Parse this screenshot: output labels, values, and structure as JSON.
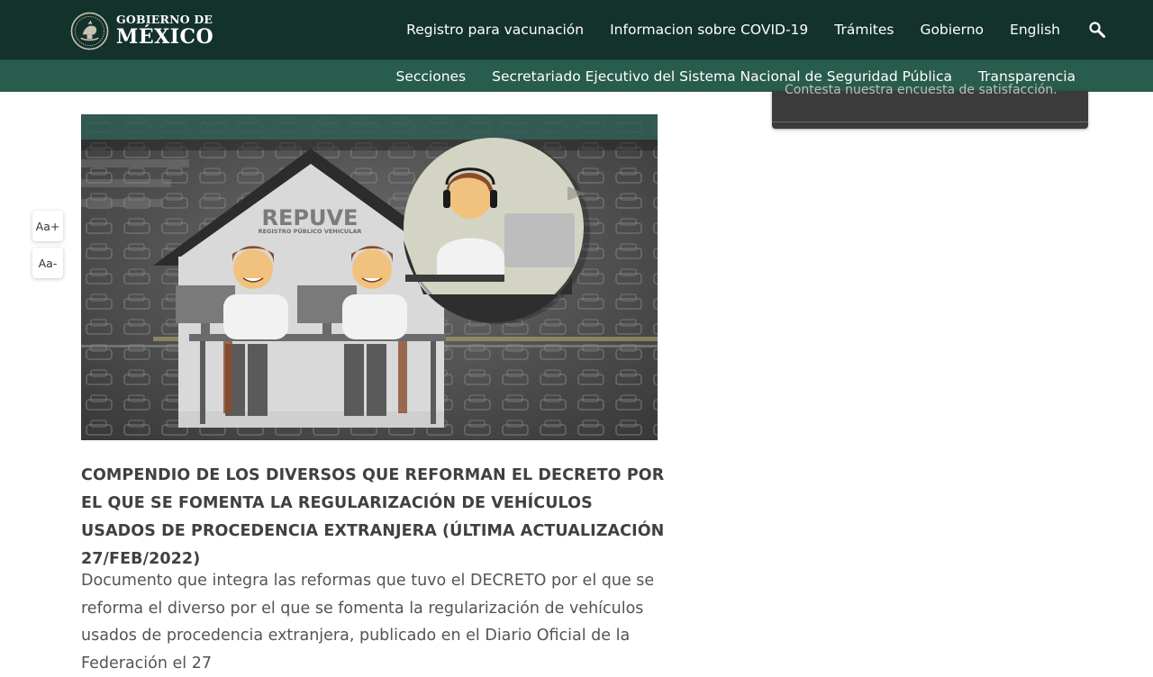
{
  "header": {
    "brand_line1": "GOBIERNO DE",
    "brand_line2": "MÉXICO",
    "nav": [
      "Registro para vacunación",
      "Informacion sobre COVID-19",
      "Trámites",
      "Gobierno",
      "English"
    ],
    "search_icon": "search-icon"
  },
  "subnav": [
    "Secciones",
    "Secretariado Ejecutivo del Sistema Nacional de Seguridad Pública",
    "Transparencia"
  ],
  "widget": {
    "text": "Contesta nuestra encuesta de satisfacción."
  },
  "font_controls": {
    "increase": "Aa+",
    "decrease": "Aa-"
  },
  "hero": {
    "sign_title": "REPUVE",
    "sign_subtitle": "REGISTRO PÚBLICO VEHICULAR"
  },
  "article": {
    "title": "COMPENDIO DE LOS DIVERSOS QUE REFORMAN EL DECRETO POR EL QUE SE FOMENTA LA REGULARIZACIÓN DE VEHÍCULOS USADOS DE PROCEDENCIA EXTRANJERA (ÚLTIMA ACTUALIZACIÓN 27/FEB/2022)",
    "body": "Documento que integra las reformas que tuvo el DECRETO por el que se reforma el diverso por el que se fomenta la regularización de vehículos usados de procedencia extranjera, publicado en el Diario Oficial de la Federación el 27"
  },
  "colors": {
    "topbar": "#13322b",
    "subbar": "#285c4d",
    "headline": "#404040",
    "body": "#545454"
  }
}
